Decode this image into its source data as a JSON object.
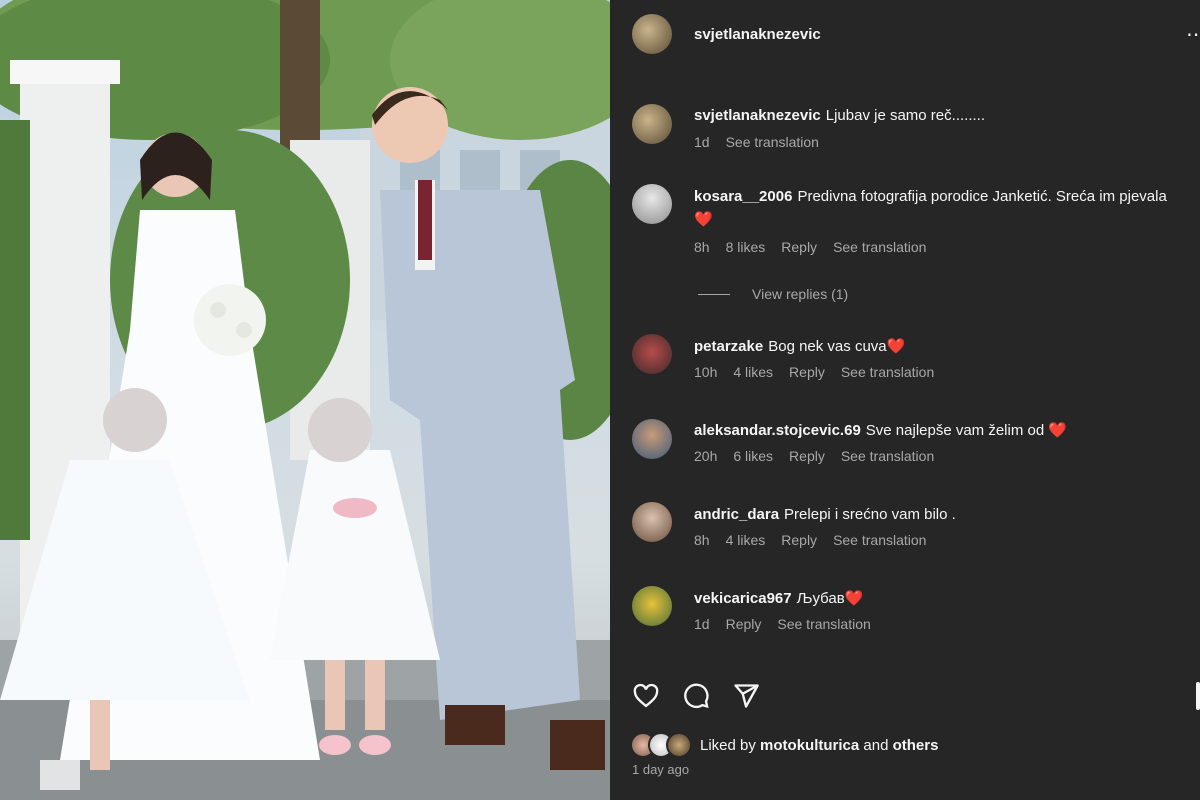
{
  "post": {
    "author": "svjetlanaknezevic",
    "more_icon": "more-dots-icon",
    "caption": {
      "username": "svjetlanaknezevic",
      "text": "Ljubav je samo reč........",
      "age": "1d",
      "see_translation": "See translation"
    }
  },
  "comments": [
    {
      "username": "kosara__2006",
      "text": "Predivna fotografija porodice Janketić. Sreća im pjevala",
      "emoji": "❤️",
      "age": "8h",
      "likes": "8 likes",
      "reply": "Reply",
      "see_translation": "See translation",
      "view_replies": "View replies (1)"
    },
    {
      "username": "petarzake",
      "text": "Bog nek vas cuva",
      "emoji": "❤️",
      "age": "10h",
      "likes": "4 likes",
      "reply": "Reply",
      "see_translation": "See translation"
    },
    {
      "username": "aleksandar.stojcevic.69",
      "text": "Sve najlepše vam želim od",
      "emoji": "❤️",
      "age": "20h",
      "likes": "6 likes",
      "reply": "Reply",
      "see_translation": "See translation"
    },
    {
      "username": "andric_dara",
      "text": "Prelepi i srećno vam bilo .",
      "emoji": "",
      "age": "8h",
      "likes": "4 likes",
      "reply": "Reply",
      "see_translation": "See translation"
    },
    {
      "username": "vekicarica967",
      "text": "Љубав",
      "emoji": "❤️",
      "age": "1d",
      "likes": "",
      "reply": "Reply",
      "see_translation": "See translation"
    }
  ],
  "actions": {
    "like_icon": "heart-icon",
    "comment_icon": "comment-icon",
    "share_icon": "share-icon"
  },
  "liked_by": {
    "prefix": "Liked by",
    "user": "motokulturica",
    "and": "and",
    "others": "others"
  },
  "timestamp": "1 day ago",
  "colors": {
    "panel_bg": "#262626",
    "text": "#f5f5f5",
    "secondary_text": "#a8a8a8",
    "heart": "#ff3040"
  }
}
